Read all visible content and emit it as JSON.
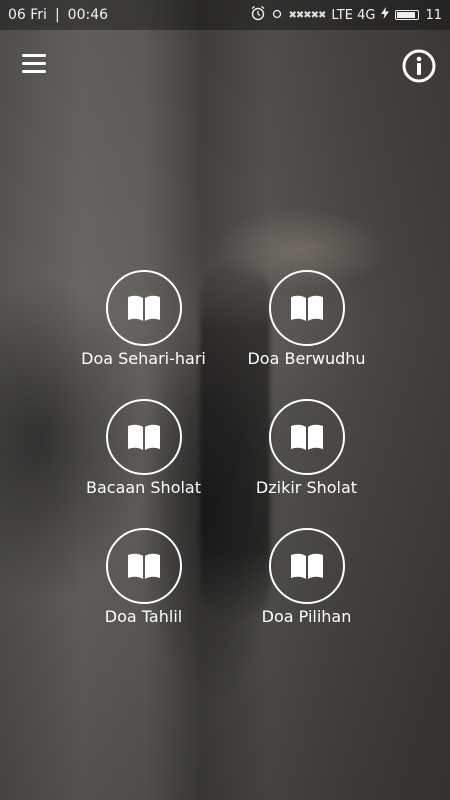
{
  "status_bar": {
    "date": "06 Fri",
    "separator": "|",
    "time": "00:46",
    "signal_dots": "✖✖✖✖✖",
    "network": "LTE 4G",
    "battery_level": "11",
    "icons": [
      "alarm-icon",
      "circle-icon",
      "signal-icon",
      "charging-icon",
      "battery-icon"
    ]
  },
  "header": {
    "menu_icon": "hamburger-menu-icon",
    "info_icon": "info-circle-icon"
  },
  "menu": {
    "items": [
      {
        "label": "Doa Sehari-hari",
        "icon": "open-book-icon"
      },
      {
        "label": "Doa Berwudhu",
        "icon": "open-book-icon"
      },
      {
        "label": "Bacaan Sholat",
        "icon": "open-book-icon"
      },
      {
        "label": "Dzikir Sholat",
        "icon": "open-book-icon"
      },
      {
        "label": "Doa Tahlil",
        "icon": "open-book-icon"
      },
      {
        "label": "Doa Pilihan",
        "icon": "open-book-icon"
      }
    ]
  },
  "colors": {
    "foreground": "#ffffff",
    "status_bar_bg": "#2a2826"
  }
}
